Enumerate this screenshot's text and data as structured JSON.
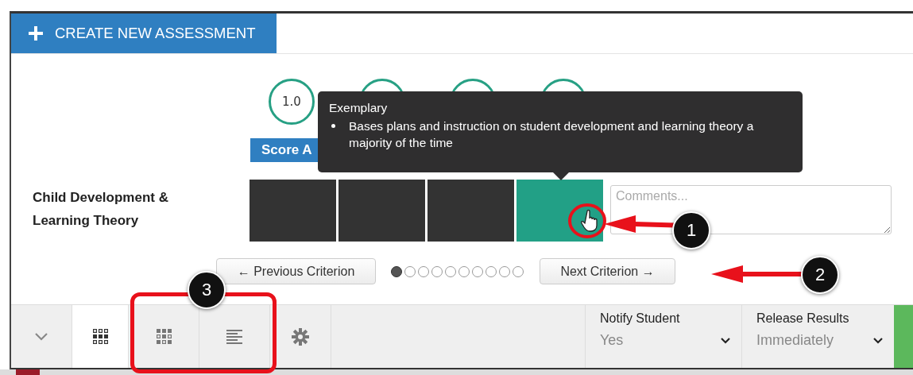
{
  "create_button": {
    "label": "CREATE NEW ASSESSMENT"
  },
  "score_circles": [
    {
      "kind": "labeled",
      "label": "1.0"
    },
    {
      "kind": "blank"
    },
    {
      "kind": "blank"
    },
    {
      "kind": "blank"
    }
  ],
  "score_button": {
    "label": "Score A"
  },
  "tooltip": {
    "title": "Exemplary",
    "items": [
      "Bases plans and instruction on student development and learning theory a majority of the time"
    ]
  },
  "criterion": {
    "name": "Child Development & Learning Theory",
    "levels": [
      {
        "selected": false
      },
      {
        "selected": false
      },
      {
        "selected": false
      },
      {
        "selected": true
      }
    ],
    "comments_placeholder": "Comments..."
  },
  "navigation": {
    "previous": "← Previous Criterion",
    "next": "Next Criterion →",
    "pages": [
      {
        "selected": true
      },
      {
        "selected": false
      },
      {
        "selected": false
      },
      {
        "selected": false
      },
      {
        "selected": false
      },
      {
        "selected": false
      },
      {
        "selected": false
      },
      {
        "selected": false
      },
      {
        "selected": false
      },
      {
        "selected": false
      }
    ]
  },
  "toolbar": {
    "views": [
      {
        "kind": "grid",
        "selected": true
      },
      {
        "kind": "dot-grid",
        "selected": false
      },
      {
        "kind": "lines",
        "selected": false
      }
    ],
    "notify": {
      "label": "Notify Student",
      "value": "Yes"
    },
    "release": {
      "label": "Release Results",
      "value": "Immediately"
    }
  },
  "callouts": [
    {
      "kind": "cursor",
      "number": "1"
    },
    {
      "kind": "next",
      "number": "2"
    },
    {
      "kind": "views",
      "number": "3"
    }
  ]
}
